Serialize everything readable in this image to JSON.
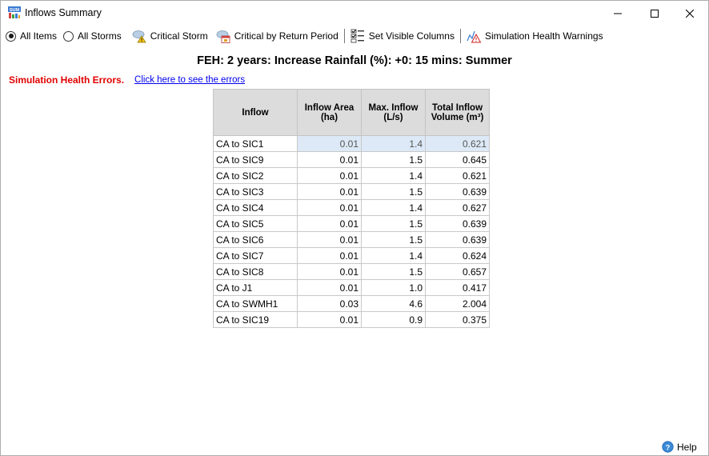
{
  "window": {
    "title": "Inflows Summary",
    "app_icon_text": "SUM"
  },
  "toolbar": {
    "all_items": "All Items",
    "all_storms": "All Storms",
    "critical_storm": "Critical Storm",
    "critical_by_return_period": "Critical by Return Period",
    "set_visible_columns": "Set Visible Columns",
    "simulation_health_warnings": "Simulation Health Warnings",
    "selected": "all_items"
  },
  "heading": "FEH: 2 years: Increase Rainfall (%): +0: 15 mins: Summer",
  "health": {
    "errors_label": "Simulation Health Errors.",
    "link_label": "Click here to see the errors"
  },
  "table": {
    "columns": [
      {
        "line1": "Inflow",
        "line2": ""
      },
      {
        "line1": "Inflow Area",
        "line2": "(ha)"
      },
      {
        "line1": "Max. Inflow",
        "line2": "(L/s)"
      },
      {
        "line1": "Total Inflow",
        "line2": "Volume (m³)"
      }
    ],
    "rows": [
      {
        "inflow": "CA to SIC1",
        "area": "0.01",
        "max": "1.4",
        "volume": "0.621"
      },
      {
        "inflow": "CA to SIC9",
        "area": "0.01",
        "max": "1.5",
        "volume": "0.645"
      },
      {
        "inflow": "CA to SIC2",
        "area": "0.01",
        "max": "1.4",
        "volume": "0.621"
      },
      {
        "inflow": "CA to SIC3",
        "area": "0.01",
        "max": "1.5",
        "volume": "0.639"
      },
      {
        "inflow": "CA to SIC4",
        "area": "0.01",
        "max": "1.4",
        "volume": "0.627"
      },
      {
        "inflow": "CA to SIC5",
        "area": "0.01",
        "max": "1.5",
        "volume": "0.639"
      },
      {
        "inflow": "CA to SIC6",
        "area": "0.01",
        "max": "1.5",
        "volume": "0.639"
      },
      {
        "inflow": "CA to SIC7",
        "area": "0.01",
        "max": "1.4",
        "volume": "0.624"
      },
      {
        "inflow": "CA to SIC8",
        "area": "0.01",
        "max": "1.5",
        "volume": "0.657"
      },
      {
        "inflow": "CA to J1",
        "area": "0.01",
        "max": "1.0",
        "volume": "0.417"
      },
      {
        "inflow": "CA to SWMH1",
        "area": "0.03",
        "max": "4.6",
        "volume": "2.004"
      },
      {
        "inflow": "CA to SIC19",
        "area": "0.01",
        "max": "0.9",
        "volume": "0.375"
      }
    ]
  },
  "footer": {
    "help_label": "Help"
  },
  "colors": {
    "error_red": "#e00000",
    "link_blue": "#0000ee",
    "header_grey": "#dcdcdc",
    "selection_blue": "#dde9f6"
  }
}
